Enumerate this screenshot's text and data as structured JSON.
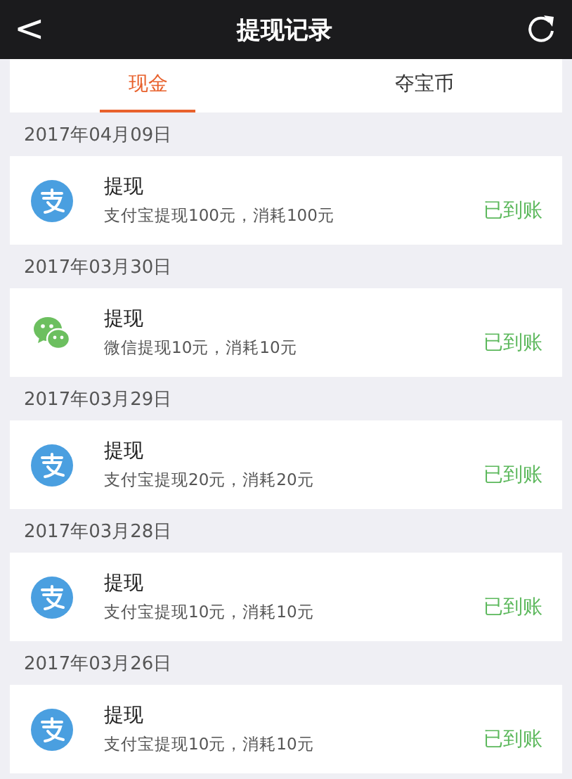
{
  "header": {
    "back": "<",
    "title": "提现记录"
  },
  "tabs": [
    {
      "label": "现金",
      "selected": true
    },
    {
      "label": "夺宝币",
      "selected": false
    }
  ],
  "groups": [
    {
      "date": "2017年04月09日",
      "records": [
        {
          "kind": "alipay",
          "title": "提现",
          "detail": "支付宝提现100元，消耗100元",
          "status": "已到账"
        }
      ]
    },
    {
      "date": "2017年03月30日",
      "records": [
        {
          "kind": "wechat",
          "title": "提现",
          "detail": "微信提现10元，消耗10元",
          "status": "已到账"
        }
      ]
    },
    {
      "date": "2017年03月29日",
      "records": [
        {
          "kind": "alipay",
          "title": "提现",
          "detail": "支付宝提现20元，消耗20元",
          "status": "已到账"
        }
      ]
    },
    {
      "date": "2017年03月28日",
      "records": [
        {
          "kind": "alipay",
          "title": "提现",
          "detail": "支付宝提现10元，消耗10元",
          "status": "已到账"
        }
      ]
    },
    {
      "date": "2017年03月26日",
      "records": [
        {
          "kind": "alipay",
          "title": "提现",
          "detail": "支付宝提现10元，消耗10元",
          "status": "已到账"
        }
      ]
    }
  ]
}
